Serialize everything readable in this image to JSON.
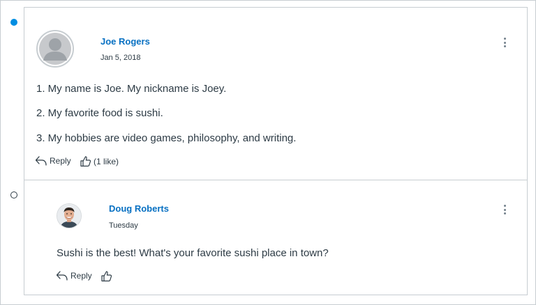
{
  "entries": [
    {
      "author": "Joe Rogers",
      "date": "Jan 5, 2018",
      "lines": [
        "1. My name is Joe. My nickname is Joey.",
        "2. My favorite food is sushi.",
        "3. My hobbies are video games, philosophy, and writing."
      ],
      "reply_label": "Reply",
      "like_label": "(1 like)",
      "unread": true
    },
    {
      "author": "Doug Roberts",
      "date": "Tuesday",
      "text": "Sushi is the best! What's your favorite sushi place in town?",
      "reply_label": "Reply",
      "like_label": "",
      "unread": false
    }
  ],
  "colors": {
    "accent": "#008ee2",
    "author_link": "#0770c2",
    "text": "#2d3b45",
    "border": "#c7cdd1"
  },
  "icons": [
    "unread-dot-icon",
    "read-dot-icon",
    "kebab-menu-icon",
    "reply-arrow-icon",
    "thumbs-up-icon",
    "default-avatar-icon"
  ]
}
